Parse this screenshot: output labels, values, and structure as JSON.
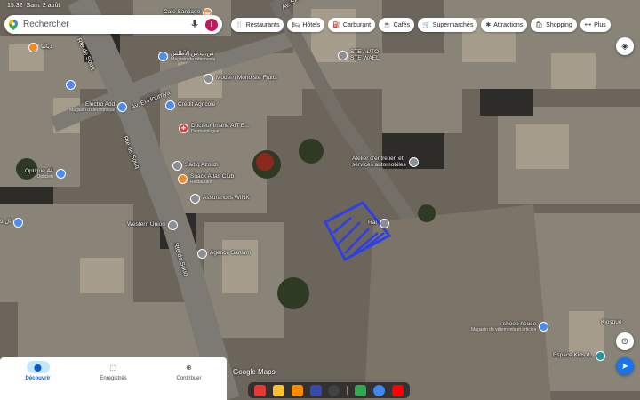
{
  "status": {
    "time": "15:32",
    "date": "Sam. 2 août"
  },
  "search": {
    "placeholder": "Rechercher",
    "avatar_letter": "I"
  },
  "colors": {
    "accent": "#1a73e8",
    "selection": "#2f3fe8",
    "avatar": "#c2185b"
  },
  "chips": [
    {
      "icon": "fork-knife-icon",
      "glyph": "🍴",
      "label": "Restaurants"
    },
    {
      "icon": "bed-icon",
      "glyph": "🛏",
      "label": "Hôtels"
    },
    {
      "icon": "fuel-icon",
      "glyph": "⛽",
      "label": "Carburant"
    },
    {
      "icon": "coffee-icon",
      "glyph": "☕",
      "label": "Cafés"
    },
    {
      "icon": "cart-icon",
      "glyph": "🛒",
      "label": "Supermarchés"
    },
    {
      "icon": "attraction-icon",
      "glyph": "✱",
      "label": "Attractions"
    },
    {
      "icon": "bag-icon",
      "glyph": "🛍",
      "label": "Shopping"
    },
    {
      "icon": "more-icon",
      "glyph": "•••",
      "label": "Plus"
    }
  ],
  "roads": {
    "av_el_hourriya": "Av. El-Hourriya",
    "av_el_hourriya_top": "Av. El-Hourr",
    "rte_souq_1": "Rte de Souq",
    "rte_souq_2": "Rte de Souq",
    "rte_souq_3": "Rte de Souq"
  },
  "pois": {
    "cafe_santiago": {
      "name": "Cafe Santiago",
      "sub": ""
    },
    "sbs_atlas": {
      "name": "س.ب.س الأطلس",
      "sub": "Magasin de vêtements"
    },
    "ste_auto": {
      "name": "STE AUTO",
      "sub": "STE WAEL"
    },
    "modern_mono": {
      "name": "Modern Mono ste Fruits",
      "sub": ""
    },
    "electro_add": {
      "name": "Electro Add",
      "sub": "Magasin d'électronique"
    },
    "credit_agricole": {
      "name": "Crédit Agricole",
      "sub": ""
    },
    "docteur": {
      "name": "Docteur Imane AIT E...",
      "sub": "Dermatologue"
    },
    "atelier": {
      "name": "Atelier d'entretien et",
      "sub": "services automobiles"
    },
    "sadiq": {
      "name": "Sadiq Azouzi",
      "sub": ""
    },
    "snack": {
      "name": "Snack Atlas Club",
      "sub": "Restaurant"
    },
    "assurances": {
      "name": "Assurances WINK",
      "sub": ""
    },
    "optique": {
      "name": "Optique 44",
      "sub": "Opticien"
    },
    "western": {
      "name": "Western Union",
      "sub": ""
    },
    "rai": {
      "name": "Raï",
      "sub": ""
    },
    "agence": {
      "name": "Agence Sanlam",
      "sub": ""
    },
    "left_edge": {
      "name": "9 ال",
      "sub": ""
    },
    "shoop": {
      "name": "shoop house",
      "sub": "Magasin de vêtements et articles"
    },
    "esta": {
      "name": "Espace Kids d..",
      "sub": ""
    },
    "kiosque": {
      "name": "Kiosque",
      "sub": ""
    },
    "top_left": {
      "name": "ديالنا",
      "sub": ""
    }
  },
  "bottom_nav": [
    {
      "icon": "pin-icon",
      "glyph": "⬤",
      "label": "Découvrir",
      "active": true
    },
    {
      "icon": "bookmark-icon",
      "glyph": "⬚",
      "label": "Enregistrés",
      "active": false
    },
    {
      "icon": "plus-circle-icon",
      "glyph": "⊕",
      "label": "Contribuer",
      "active": false
    }
  ],
  "google_mark": "Google Maps",
  "dock_apps": [
    {
      "name": "app-red-icon",
      "color": "#e53935"
    },
    {
      "name": "app-files-icon",
      "color": "#fbc02d"
    },
    {
      "name": "app-orange-icon",
      "color": "#fb8c00"
    },
    {
      "name": "app-browser-icon",
      "color": "#3949ab"
    },
    {
      "name": "app-camera-icon",
      "color": "#424242"
    },
    {
      "name": "app-maps-icon",
      "color": "#34a853"
    },
    {
      "name": "app-chrome-icon",
      "color": "#4285f4"
    },
    {
      "name": "app-youtube-icon",
      "color": "#ff0000"
    }
  ]
}
